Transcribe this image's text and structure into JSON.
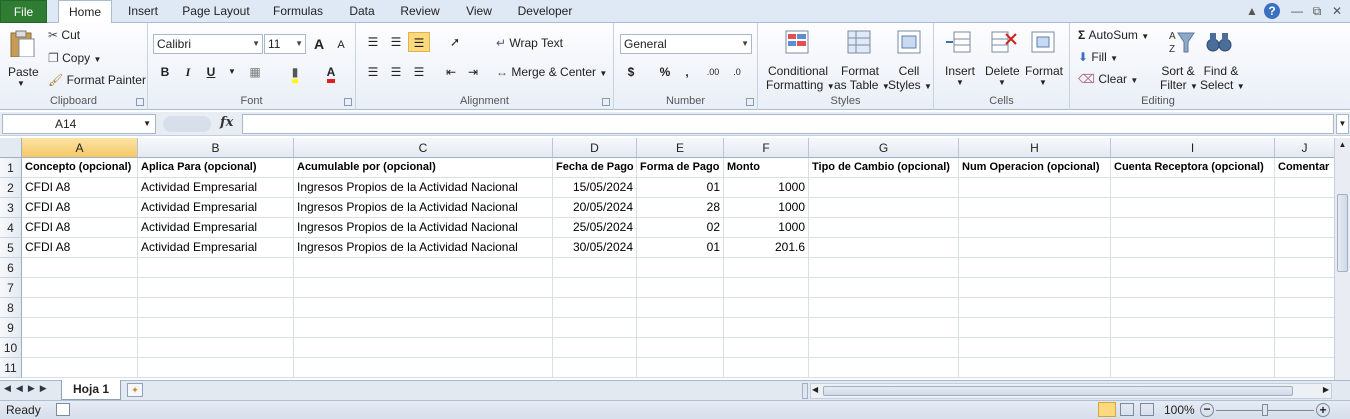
{
  "ribbon_tabs": [
    "File",
    "Home",
    "Insert",
    "Page Layout",
    "Formulas",
    "Data",
    "Review",
    "View",
    "Developer"
  ],
  "window_controls": {
    "help": "?"
  },
  "clipboard": {
    "paste": "Paste",
    "cut": "Cut",
    "copy": "Copy",
    "format_painter": "Format Painter",
    "label": "Clipboard"
  },
  "font": {
    "name": "Calibri",
    "size": "11",
    "bold": "B",
    "italic": "I",
    "underline": "U",
    "grow": "A",
    "shrink": "A",
    "label": "Font"
  },
  "alignment": {
    "wrap_text": "Wrap Text",
    "merge_center": "Merge & Center",
    "label": "Alignment"
  },
  "number": {
    "format": "General",
    "currency": "$",
    "percent": "%",
    "comma": ",",
    "inc_decimal": ".00",
    "dec_decimal": ".0",
    "label": "Number"
  },
  "styles": {
    "conditional_formatting_1": "Conditional",
    "conditional_formatting_2": "Formatting",
    "format_as_table_1": "Format",
    "format_as_table_2": "as Table",
    "cell_styles_1": "Cell",
    "cell_styles_2": "Styles",
    "label": "Styles"
  },
  "cells": {
    "insert": "Insert",
    "delete": "Delete",
    "format": "Format",
    "label": "Cells"
  },
  "editing": {
    "autosum": "AutoSum",
    "fill": "Fill",
    "clear": "Clear",
    "sort_filter_1": "Sort &",
    "sort_filter_2": "Filter",
    "find_select_1": "Find &",
    "find_select_2": "Select",
    "label": "Editing"
  },
  "formula_bar": {
    "name_box": "A14",
    "fx": "fx",
    "value": ""
  },
  "columns": [
    "A",
    "B",
    "C",
    "D",
    "E",
    "F",
    "G",
    "H",
    "I",
    "J"
  ],
  "active_column": "A",
  "row_numbers": [
    "1",
    "2",
    "3",
    "4",
    "5",
    "6",
    "7",
    "8",
    "9",
    "10",
    "11"
  ],
  "rows": [
    [
      "Concepto (opcional)",
      "Aplica Para (opcional)",
      "Acumulable por (opcional)",
      "Fecha de Pago",
      "Forma de Pago",
      "Monto",
      "Tipo de Cambio (opcional)",
      "Num Operacion (opcional)",
      "Cuenta Receptora (opcional)",
      "Comentar"
    ],
    [
      "CFDI A8",
      "Actividad Empresarial",
      "Ingresos Propios de la Actividad Nacional",
      "15/05/2024",
      "01",
      "1000",
      "",
      "",
      "",
      ""
    ],
    [
      "CFDI A8",
      "Actividad Empresarial",
      "Ingresos Propios de la Actividad Nacional",
      "20/05/2024",
      "28",
      "1000",
      "",
      "",
      "",
      ""
    ],
    [
      "CFDI A8",
      "Actividad Empresarial",
      "Ingresos Propios de la Actividad Nacional",
      "25/05/2024",
      "02",
      "1000",
      "",
      "",
      "",
      ""
    ],
    [
      "CFDI A8",
      "Actividad Empresarial",
      "Ingresos Propios de la Actividad Nacional",
      "30/05/2024",
      "01",
      "201.6",
      "",
      "",
      "",
      ""
    ]
  ],
  "sheet_tab": "Hoja 1",
  "status": {
    "ready": "Ready",
    "zoom": "100%"
  }
}
